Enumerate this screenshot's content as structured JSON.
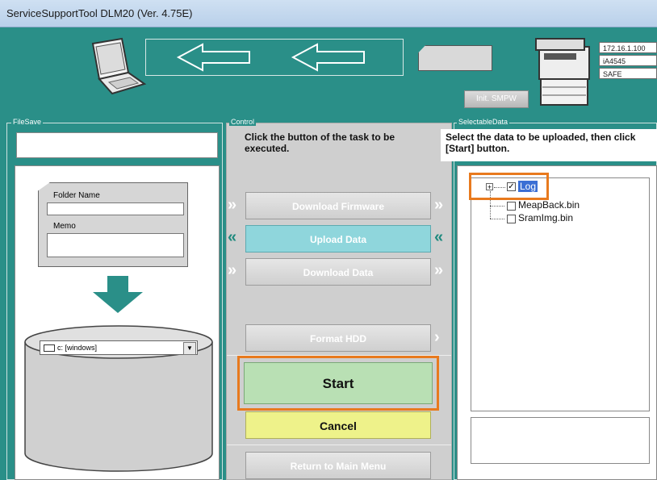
{
  "window": {
    "title": "ServiceSupportTool DLM20 (Ver. 4.75E)"
  },
  "device": {
    "ip": "172.16.1.100",
    "model": "iA4545",
    "mode": "SAFE"
  },
  "init_button": "Init. SMPW",
  "filesave": {
    "label": "FileSave",
    "folder_label": "Folder Name",
    "memo_label": "Memo",
    "drive": "c: [windows]"
  },
  "control": {
    "label": "Control",
    "instruction": "Click the button of the task to be executed.",
    "buttons": {
      "download_firmware": "Download Firmware",
      "upload_data": "Upload Data",
      "download_data": "Download Data",
      "format_hdd": "Format HDD",
      "start": "Start",
      "cancel": "Cancel",
      "return": "Return to Main Menu"
    }
  },
  "selectable": {
    "label": "SelectableData",
    "instruction": "Select the data to be uploaded, then click [Start] button.",
    "tree": [
      {
        "label": "Log",
        "checked": true
      },
      {
        "label": "MeapBack.bin",
        "checked": false
      },
      {
        "label": "SramImg.bin",
        "checked": false
      }
    ]
  },
  "colors": {
    "teal": "#2a8f88",
    "highlight": "#e87a1e",
    "upload_active": "#8fd6dc",
    "start": "#b9e0b4",
    "cancel": "#eef28a"
  }
}
